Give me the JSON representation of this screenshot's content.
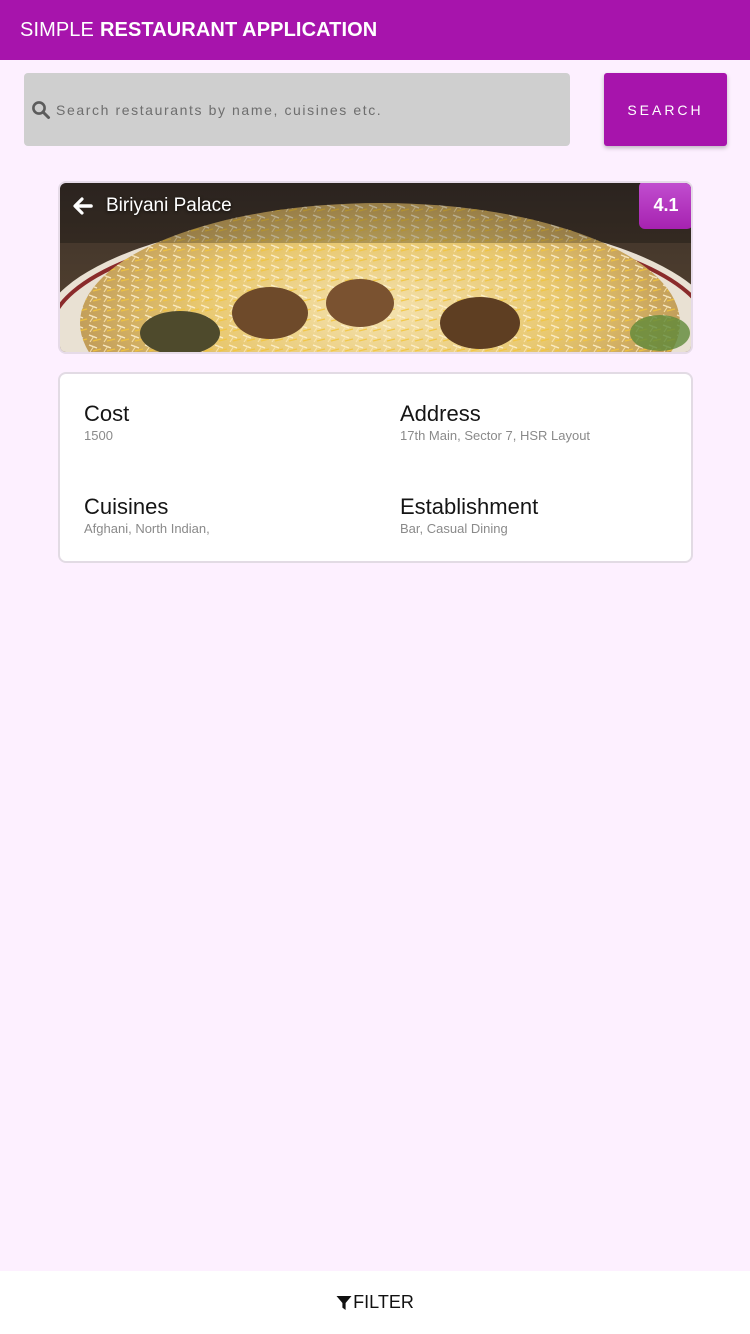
{
  "app": {
    "title_light": "SIMPLE",
    "title_bold": "RESTAURANT APPLICATION",
    "brand_color": "#a714ac"
  },
  "search": {
    "placeholder": "Search restaurants by name, cuisines etc.",
    "value": "",
    "icon": "search-icon",
    "button_label": "SEARCH"
  },
  "restaurant": {
    "name": "Biriyani Palace",
    "rating": "4.1",
    "back_icon": "arrow-left-icon",
    "image": "biriyani-dish-photo"
  },
  "details": {
    "cost_label": "Cost",
    "cost_value": "1500",
    "address_label": "Address",
    "address_value": "17th Main, Sector 7, HSR Layout",
    "cuisines_label": "Cuisines",
    "cuisines_value": "Afghani, North Indian,",
    "establishment_label": "Establishment",
    "establishment_value": "Bar, Casual Dining"
  },
  "bottom_bar": {
    "filter_label": "FILTER",
    "icon": "filter-icon"
  }
}
